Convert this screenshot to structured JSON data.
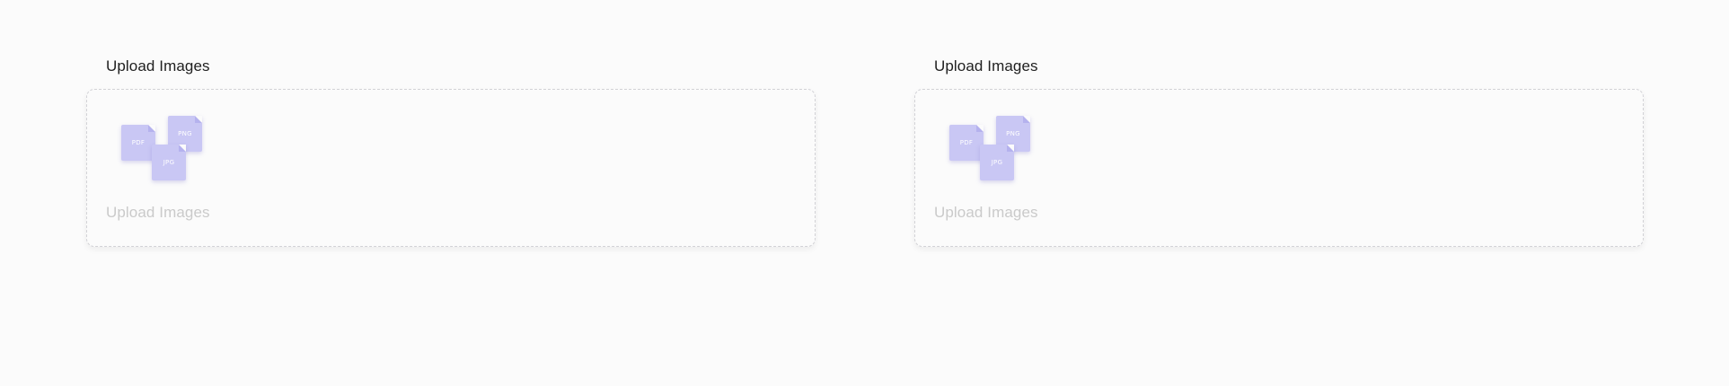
{
  "uploaders": [
    {
      "label": "Upload Images",
      "dropzone_text": "Upload Images",
      "file_types": [
        "PDF",
        "PNG",
        "JPG"
      ]
    },
    {
      "label": "Upload Images",
      "dropzone_text": "Upload Images",
      "file_types": [
        "PDF",
        "PNG",
        "JPG"
      ]
    }
  ],
  "colors": {
    "background": "#fbfbfb",
    "label": "#1f1f1f",
    "placeholder": "#cacaca",
    "border": "#d2d2d6",
    "file_icon": "#c9c7f4"
  }
}
